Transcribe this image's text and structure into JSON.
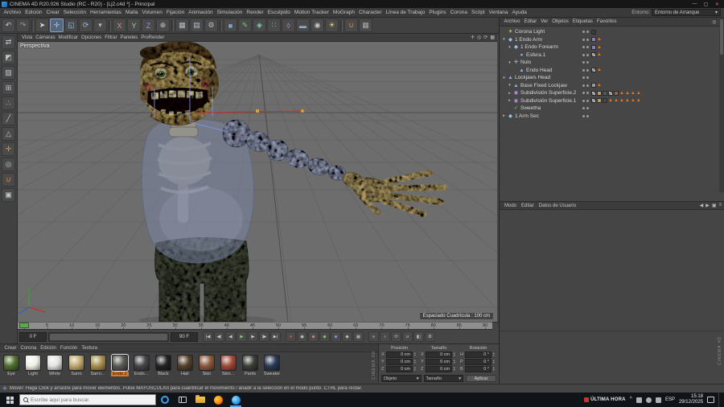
{
  "window": {
    "title": "CINEMA 4D R20.026 Studio (RC - R20) - [Lj2.c4d *] - Principal",
    "controls": {
      "min": "—",
      "max": "▢",
      "close": "✕"
    }
  },
  "menubar": {
    "items": [
      "Archivo",
      "Edición",
      "Crear",
      "Selección",
      "Herramientas",
      "Malla",
      "Volumen",
      "Fijación",
      "Animación",
      "Simulación",
      "Render",
      "Esculpido",
      "Motion Tracker",
      "MoGraph",
      "Character",
      "Línea de Trabajo",
      "Plugins",
      "Corona",
      "Script",
      "Ventana",
      "Ayuda"
    ],
    "layout_label": "Entorno:",
    "layout_value": "Entorno de Arranque",
    "layout_arrow": "▾"
  },
  "toolbar": {
    "buttons": [
      {
        "name": "undo",
        "glyph": "↶",
        "color": "#c9cdd4"
      },
      {
        "name": "redo",
        "glyph": "↷",
        "color": "#9aa0a8"
      },
      {
        "name": "separator"
      },
      {
        "name": "live-selection",
        "glyph": "➤",
        "color": "#d8d8d8"
      },
      {
        "name": "move-tool",
        "glyph": "✛",
        "color": "#9cc8f2",
        "active": true
      },
      {
        "name": "scale-tool",
        "glyph": "◱",
        "color": "#8fc0f0"
      },
      {
        "name": "rotate-tool",
        "glyph": "⟳",
        "color": "#8fc0f0"
      },
      {
        "name": "last-tool-dropdown",
        "glyph": "▾",
        "color": "#b8b8b8"
      },
      {
        "name": "separator"
      },
      {
        "name": "lock-x-axis",
        "glyph": "X",
        "color": "#d89090"
      },
      {
        "name": "lock-y-axis",
        "glyph": "Y",
        "color": "#90d890"
      },
      {
        "name": "lock-z-axis",
        "glyph": "Z",
        "color": "#9090d8"
      },
      {
        "name": "coordinate-system",
        "glyph": "⊕",
        "color": "#c8c8c8"
      },
      {
        "name": "separator"
      },
      {
        "name": "render-view",
        "glyph": "▦",
        "color": "#b8bcc4"
      },
      {
        "name": "render-picture-viewer",
        "glyph": "▤",
        "color": "#b8bcc4"
      },
      {
        "name": "render-settings",
        "glyph": "⚙",
        "color": "#b8bcc4"
      },
      {
        "name": "separator"
      },
      {
        "name": "add-primitive-cube",
        "glyph": "■",
        "color": "#7fa8d8"
      },
      {
        "name": "add-spline-pen",
        "glyph": "✎",
        "color": "#86c06a"
      },
      {
        "name": "add-generator",
        "glyph": "◈",
        "color": "#7fd0b0"
      },
      {
        "name": "add-mograph",
        "glyph": "∷",
        "color": "#70c8c0"
      },
      {
        "name": "add-deformer",
        "glyph": "◊",
        "color": "#b090d8"
      },
      {
        "name": "add-environment",
        "glyph": "▬",
        "color": "#90a8b8"
      },
      {
        "name": "add-camera",
        "glyph": "◉",
        "color": "#c8c8c8"
      },
      {
        "name": "add-light",
        "glyph": "☀",
        "color": "#e8d06a"
      },
      {
        "name": "separator"
      },
      {
        "name": "snap-settings",
        "glyph": "∪",
        "color": "#e09040"
      },
      {
        "name": "workplane-settings",
        "glyph": "▦",
        "color": "#a8a8a8"
      }
    ]
  },
  "left_toolbar": {
    "buttons": [
      {
        "name": "make-editable",
        "glyph": "⇄",
        "color": "#c0c4cc"
      },
      {
        "name": "model-mode",
        "glyph": "◩",
        "color": "#c0c4cc"
      },
      {
        "name": "texture-mode",
        "glyph": "▨",
        "color": "#c0c4cc"
      },
      {
        "name": "workplane-mode",
        "glyph": "⊞",
        "color": "#c0c4cc"
      },
      {
        "name": "points-mode",
        "glyph": "∴",
        "color": "#c0c4cc"
      },
      {
        "name": "edges-mode",
        "glyph": "╱",
        "color": "#c0c4cc"
      },
      {
        "name": "polygons-mode",
        "glyph": "△",
        "color": "#c0c4cc"
      },
      {
        "name": "enable-axis-mode",
        "glyph": "✛",
        "color": "#d0a060"
      },
      {
        "name": "viewport-solo",
        "glyph": "◎",
        "color": "#c0c4cc"
      },
      {
        "name": "snap-toggle",
        "glyph": "∪",
        "color": "#e09040"
      },
      {
        "name": "locked-workplane",
        "glyph": "▣",
        "color": "#c0c4cc"
      }
    ]
  },
  "viewport": {
    "menu": [
      "Vista",
      "Cámaras",
      "Modificar",
      "Opciones",
      "Filtrar",
      "Paneles",
      "ProRender"
    ],
    "corner_icons": [
      {
        "name": "pan-view",
        "glyph": "✛"
      },
      {
        "name": "zoom-view",
        "glyph": "◎"
      },
      {
        "name": "rotate-view",
        "glyph": "⟳"
      },
      {
        "name": "toggle-views",
        "glyph": "▦"
      }
    ],
    "view_label": "Perspectiva",
    "grid_label": "Espaciado Cuadrícula : 100 cm"
  },
  "object_manager": {
    "menu": [
      "Archivo",
      "Editar",
      "Ver",
      "Objetos",
      "Etiquetas",
      "Favoritos"
    ],
    "corner_icons": [
      {
        "name": "om-search",
        "glyph": "◎"
      },
      {
        "name": "om-filter",
        "glyph": "≡"
      }
    ],
    "objects": [
      {
        "name": "Corona Light",
        "icon": "light",
        "indent": 0,
        "expander": "",
        "tags": [
          "#3a3a3a"
        ]
      },
      {
        "name": "1 Endo Arm",
        "icon": "joint",
        "indent": 0,
        "expander": "▾",
        "tags": [
          "#8a80b0",
          "tri"
        ]
      },
      {
        "name": "1 Endo Forearm",
        "icon": "joint",
        "indent": 1,
        "expander": "▾",
        "tags": [
          "#8a80b0",
          "tri"
        ]
      },
      {
        "name": "Esfera.1",
        "icon": "sphere",
        "indent": 2,
        "expander": "",
        "tags": [
          "chk",
          "tri"
        ]
      },
      {
        "name": "Nulo",
        "icon": "null",
        "indent": 1,
        "expander": "▾",
        "tags": []
      },
      {
        "name": "Endo Head",
        "icon": "mesh",
        "indent": 2,
        "expander": "",
        "tags": [
          "chk",
          "tri"
        ]
      },
      {
        "name": "Lockjaws Head",
        "icon": "mesh",
        "indent": 0,
        "expander": "▾",
        "tags": []
      },
      {
        "name": "Base Fixed Lockjaw",
        "icon": "mesh",
        "indent": 1,
        "expander": "▾",
        "tags": [
          "#9a9a9a",
          "tri"
        ]
      },
      {
        "name": "Subdivisión Superficie.2",
        "icon": "subdiv",
        "indent": 1,
        "expander": "▸",
        "tags": [
          "chk",
          "#b39a6a",
          "#555b66",
          "chk",
          "#8a6a4a",
          "tri",
          "tri",
          "tri",
          "tri"
        ]
      },
      {
        "name": "Subdivisión Superficie.1",
        "icon": "subdiv",
        "indent": 1,
        "expander": "▸",
        "tags": [
          "chk",
          "#b39a6a",
          "#44484e",
          "tri",
          "tri",
          "tri",
          "tri",
          "tri",
          "tri"
        ]
      },
      {
        "name": "Sweetha",
        "icon": "check",
        "indent": 1,
        "expander": "",
        "tags": []
      },
      {
        "name": "1 Arm Sec",
        "icon": "joint",
        "indent": 0,
        "expander": "▸",
        "tags": []
      }
    ]
  },
  "attributes": {
    "tabs": [
      "Modo",
      "Editar",
      "Datos de Usuario"
    ],
    "corner_icons": [
      {
        "name": "attr-nav-back",
        "glyph": "◀"
      },
      {
        "name": "attr-nav-forward",
        "glyph": "▶"
      },
      {
        "name": "attr-lock",
        "glyph": "▣"
      },
      {
        "name": "attr-panel-menu",
        "glyph": "≡"
      }
    ]
  },
  "timeline": {
    "ticks": [
      "0",
      "5",
      "10",
      "15",
      "20",
      "25",
      "30",
      "35",
      "40",
      "45",
      "50",
      "55",
      "60",
      "65",
      "70",
      "75",
      "80",
      "85",
      "90"
    ],
    "start_frame": "0 F",
    "end_frame": "90 F",
    "transport": [
      {
        "name": "goto-start",
        "glyph": "|◀"
      },
      {
        "name": "prev-key",
        "glyph": "◀|"
      },
      {
        "name": "prev-frame",
        "glyph": "◀"
      },
      {
        "name": "play",
        "glyph": "▶",
        "color": "#7ed06a"
      },
      {
        "name": "next-frame",
        "glyph": "▶"
      },
      {
        "name": "next-key",
        "glyph": "|▶"
      },
      {
        "name": "goto-end",
        "glyph": "▶|"
      }
    ],
    "record": [
      {
        "name": "record-keyframe",
        "glyph": "●",
        "color": "#e05050"
      },
      {
        "name": "autokey",
        "glyph": "◉",
        "color": "#d0d0d0"
      },
      {
        "name": "record-position",
        "glyph": "◆",
        "color": "#d08080"
      },
      {
        "name": "record-scale",
        "glyph": "◆",
        "color": "#80c080"
      },
      {
        "name": "record-rotation",
        "glyph": "◆",
        "color": "#8090d0"
      },
      {
        "name": "record-parameter",
        "glyph": "◆",
        "color": "#c0c0c0"
      },
      {
        "name": "record-pla",
        "glyph": "▦",
        "color": "#c0c0c0"
      }
    ],
    "extras": [
      {
        "name": "playback-options",
        "glyph": "≡"
      },
      {
        "name": "sound-toggle",
        "glyph": "♪"
      },
      {
        "name": "loop-mode",
        "glyph": "⟳"
      },
      {
        "name": "key-snap",
        "glyph": "∪"
      },
      {
        "name": "key-interpolation",
        "glyph": "◧"
      },
      {
        "name": "timeline-settings",
        "glyph": "⚙"
      }
    ]
  },
  "materials": {
    "menu": [
      "Crear",
      "Corona",
      "Edición",
      "Función",
      "Textura"
    ],
    "items": [
      {
        "name": "Eye",
        "color": "#4f6f2f"
      },
      {
        "name": "Light",
        "color": "#efefe8"
      },
      {
        "name": "White",
        "color": "#e2e2e0"
      },
      {
        "name": "Sarro",
        "color": "#c0aa70"
      },
      {
        "name": "Sarro…",
        "color": "#a89050"
      },
      {
        "name": "Endo 2",
        "color": "#5a5a55",
        "selected": true
      },
      {
        "name": "Endo…",
        "color": "#46464a"
      },
      {
        "name": "Black",
        "color": "#232323"
      },
      {
        "name": "Hair",
        "color": "#54422c"
      },
      {
        "name": "Skin",
        "color": "#8a5a40"
      },
      {
        "name": "Skin…",
        "color": "#a04a3a"
      },
      {
        "name": "Pants",
        "color": "#3c4038"
      },
      {
        "name": "Sweater",
        "color": "#2c3a55"
      }
    ]
  },
  "coordinates": {
    "groups": [
      {
        "title": "Posición",
        "rows": [
          {
            "axis": "X",
            "value": "0 cm"
          },
          {
            "axis": "Y",
            "value": "0 cm"
          },
          {
            "axis": "Z",
            "value": "0 cm"
          }
        ]
      },
      {
        "title": "Tamaño",
        "rows": [
          {
            "axis": "X",
            "value": "0 cm"
          },
          {
            "axis": "Y",
            "value": "0 cm"
          },
          {
            "axis": "Z",
            "value": "0 cm"
          }
        ]
      },
      {
        "title": "Rotación",
        "rows": [
          {
            "axis": "H",
            "value": "0 °"
          },
          {
            "axis": "P",
            "value": "0 °"
          },
          {
            "axis": "B",
            "value": "0 °"
          }
        ]
      }
    ],
    "mode_object": "Objeto",
    "mode_size": "Tamaño",
    "apply": "Aplicar",
    "select_arrow": "▾"
  },
  "branding": {
    "dock_label": "CINEMA 4D"
  },
  "statusbar": {
    "message": "Mover: Haga Click y arrastre para mover elementos. Pulse MAYÚSCULAS para cuantificar el movimiento / añadir a la selección en el modo punto. CTRL para restar."
  },
  "taskbar": {
    "search_placeholder": "Escribe aquí para buscar.",
    "news_label": "ÚLTIMA HORA",
    "tray_chevron": "^",
    "lang": "ESP",
    "time": "15:18",
    "date": "29/12/2025"
  }
}
